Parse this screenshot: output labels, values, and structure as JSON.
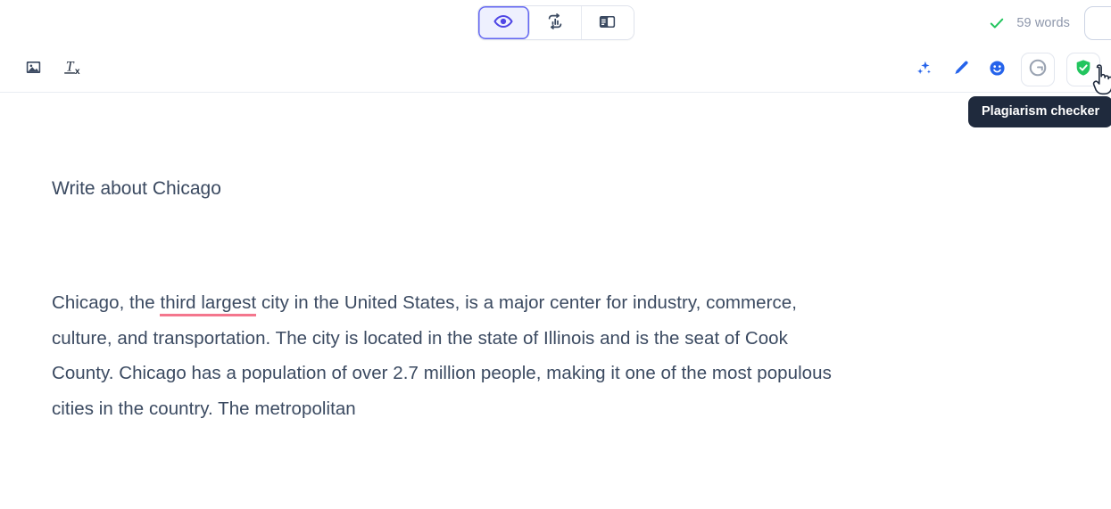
{
  "topbar": {
    "view_modes": [
      {
        "id": "preview",
        "label": "Preview",
        "icon": "eye-icon",
        "active": true
      },
      {
        "id": "stats",
        "label": "Statistics",
        "icon": "chart-refresh-icon",
        "active": false
      },
      {
        "id": "sidebar",
        "label": "Sidebar layout",
        "icon": "panel-layout-icon",
        "active": false
      }
    ],
    "status_icon": "check-icon",
    "word_count": "59 words",
    "accent_color": "#6366f1",
    "check_color": "#22c55e"
  },
  "formatbar": {
    "left_tools": [
      {
        "id": "insert-image",
        "label": "Insert image",
        "icon": "image-icon"
      },
      {
        "id": "clear-format",
        "label": "Clear formatting",
        "icon": "clear-format-icon"
      }
    ],
    "right_tools": [
      {
        "id": "ai-assist",
        "label": "AI assist",
        "icon": "sparkles-icon",
        "boxed": false,
        "color": "#2563eb"
      },
      {
        "id": "rewrite",
        "label": "Rewrite",
        "icon": "pencil-icon",
        "boxed": false,
        "color": "#2563eb"
      },
      {
        "id": "emoji",
        "label": "Emoji",
        "icon": "smiley-icon",
        "boxed": false,
        "color": "#2563eb"
      },
      {
        "id": "grammar",
        "label": "Grammar checker",
        "icon": "grammarly-g-icon",
        "boxed": true,
        "color": "#9aa3b2"
      },
      {
        "id": "plagiarism",
        "label": "Plagiarism checker",
        "icon": "shield-check-icon",
        "boxed": true,
        "color": "#22c55e"
      }
    ]
  },
  "tooltip": {
    "text": "Plagiarism checker",
    "background": "#1f2a3d"
  },
  "document": {
    "title": "Write about Chicago",
    "body_before_flag": "Chicago, the ",
    "flagged_text": "third largest",
    "body_after_flag": " city in the United States, is a major center for industry, commerce, culture, and transportation. The city is located in the state of Illinois and is the seat of Cook County. Chicago has a population of over 2.7 million people, making it one of the most populous cities in the country. The metropolitan",
    "flag_color": "#f4768d",
    "text_color": "#3b4a61"
  }
}
